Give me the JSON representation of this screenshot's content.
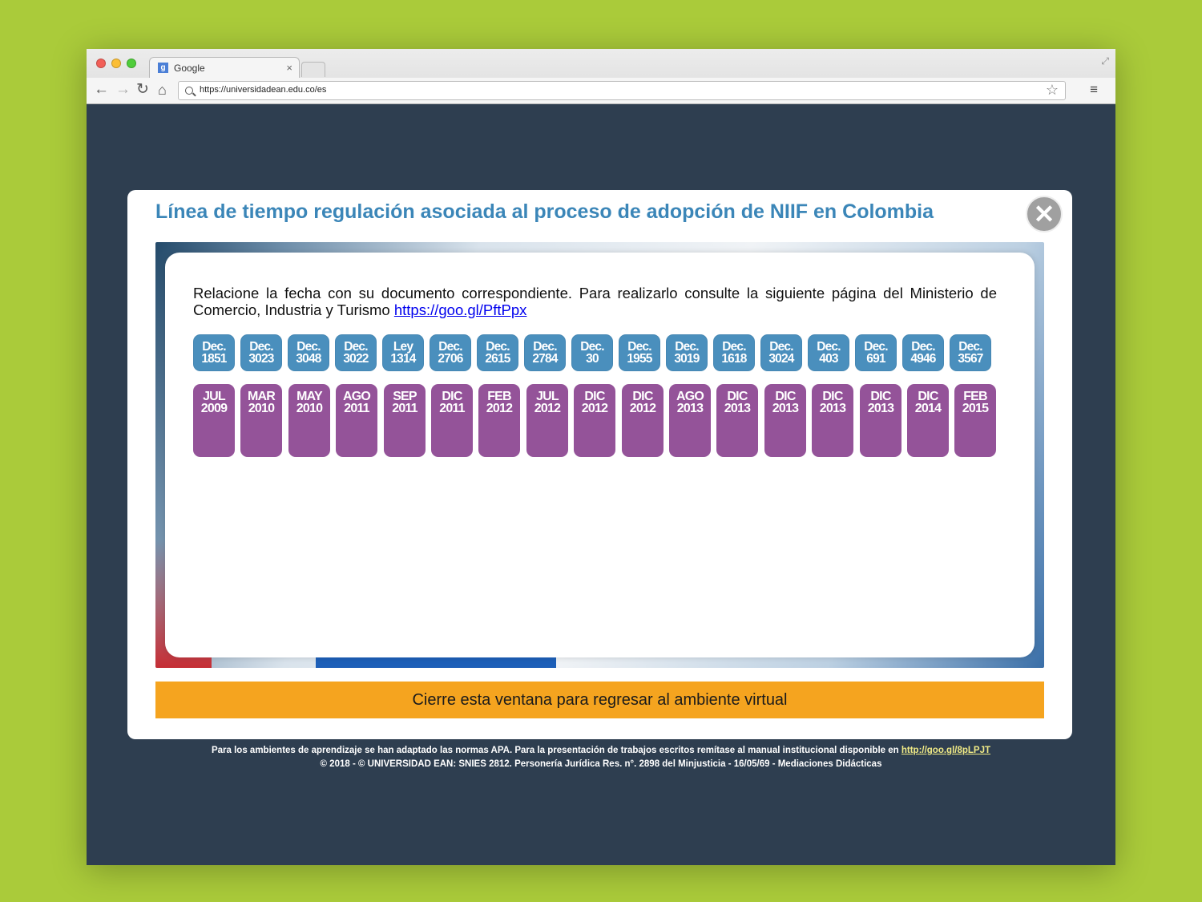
{
  "browser": {
    "tab_title": "Google",
    "tab_favicon": "g",
    "tab_close": "×",
    "url": "https://universidadean.edu.co/es"
  },
  "modal": {
    "title": "Línea de tiempo regulación asociada al proceso de adopción de NIIF en Colombia",
    "close_label": "✕",
    "instruction": "Relacione la fecha con su documento correspondiente. Para realizarlo consulte la siguiente página del Ministerio de Comercio, Industria y Turismo",
    "instruction_link": "https://goo.gl/PftPpx",
    "documents": [
      {
        "top": "Dec.",
        "bottom": "1851"
      },
      {
        "top": "Dec.",
        "bottom": "3023"
      },
      {
        "top": "Dec.",
        "bottom": "3048"
      },
      {
        "top": "Dec.",
        "bottom": "3022"
      },
      {
        "top": "Ley",
        "bottom": "1314"
      },
      {
        "top": "Dec.",
        "bottom": "2706"
      },
      {
        "top": "Dec.",
        "bottom": "2615"
      },
      {
        "top": "Dec.",
        "bottom": "2784"
      },
      {
        "top": "Dec.",
        "bottom": "30"
      },
      {
        "top": "Dec.",
        "bottom": "1955"
      },
      {
        "top": "Dec.",
        "bottom": "3019"
      },
      {
        "top": "Dec.",
        "bottom": "1618"
      },
      {
        "top": "Dec.",
        "bottom": "3024"
      },
      {
        "top": "Dec.",
        "bottom": "403"
      },
      {
        "top": "Dec.",
        "bottom": "691"
      },
      {
        "top": "Dec.",
        "bottom": "4946"
      },
      {
        "top": "Dec.",
        "bottom": "3567"
      }
    ],
    "dates": [
      {
        "month": "JUL",
        "year": "2009"
      },
      {
        "month": "MAR",
        "year": "2010"
      },
      {
        "month": "MAY",
        "year": "2010"
      },
      {
        "month": "AGO",
        "year": "2011"
      },
      {
        "month": "SEP",
        "year": "2011"
      },
      {
        "month": "DIC",
        "year": "2011"
      },
      {
        "month": "FEB",
        "year": "2012"
      },
      {
        "month": "JUL",
        "year": "2012"
      },
      {
        "month": "DIC",
        "year": "2012"
      },
      {
        "month": "DIC",
        "year": "2012"
      },
      {
        "month": "AGO",
        "year": "2013"
      },
      {
        "month": "DIC",
        "year": "2013"
      },
      {
        "month": "DIC",
        "year": "2013"
      },
      {
        "month": "DIC",
        "year": "2013"
      },
      {
        "month": "DIC",
        "year": "2013"
      },
      {
        "month": "DIC",
        "year": "2014"
      },
      {
        "month": "FEB",
        "year": "2015"
      }
    ],
    "cta": "Cierre esta ventana para regresar al ambiente virtual"
  },
  "footer": {
    "line1": "Para los ambientes de aprendizaje se han adaptado las normas APA. Para la presentación de trabajos escritos remítase al manual institucional disponible en",
    "line1_link": "http://goo.gl/8pLPJT",
    "line2": "© 2018 - © UNIVERSIDAD EAN: SNIES 2812. Personería Jurídica Res. n°. 2898 del Minjusticia - 16/05/69 - Mediaciones Didácticas"
  },
  "colors": {
    "page_background": "#aacb3a",
    "app_background": "#2e3e50",
    "title": "#3b86b8",
    "document_chip": "#4a8fbd",
    "date_chip": "#945399",
    "cta_bar": "#f5a41f",
    "footer_link": "#f1eb86"
  },
  "icons": {
    "back": "arrow-left-icon",
    "forward": "arrow-right-icon",
    "reload": "reload-icon",
    "home": "home-icon",
    "search": "search-icon",
    "bookmark": "star-icon",
    "menu": "hamburger-menu-icon",
    "close": "close-icon"
  }
}
